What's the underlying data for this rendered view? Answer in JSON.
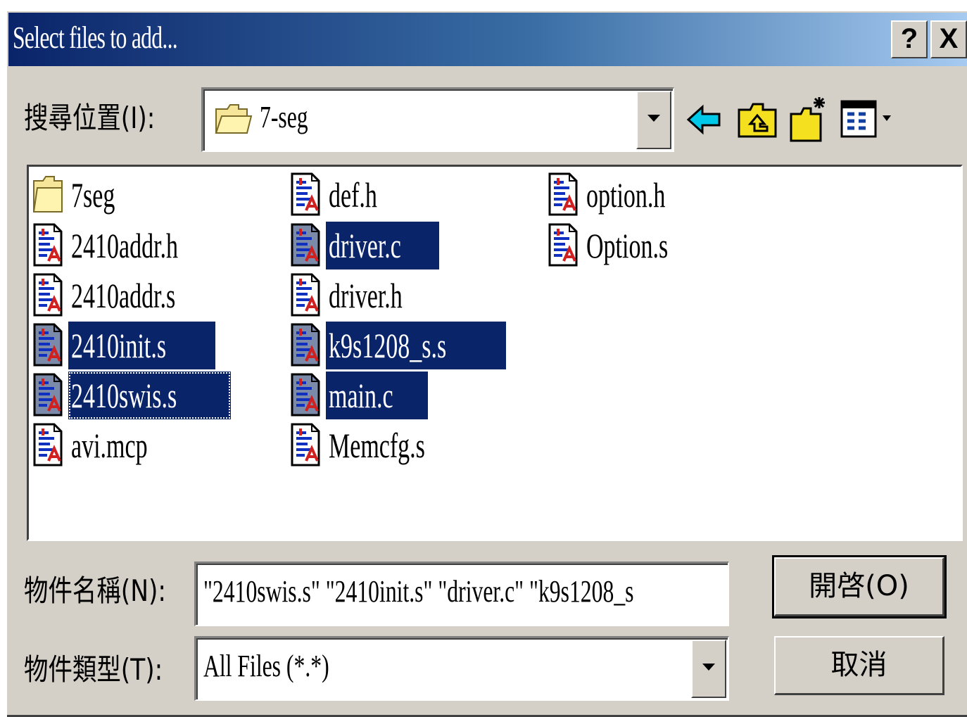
{
  "window": {
    "title": "Select files to add...",
    "help_label": "?",
    "close_label": "X"
  },
  "lookin": {
    "label": "搜尋位置(I):",
    "value": "7-seg",
    "folder_icon": "folder-icon"
  },
  "toolbar": {
    "back_icon": "back-arrow-icon",
    "up_icon": "up-folder-icon",
    "new_folder_icon": "new-folder-icon",
    "view_icon": "view-menu-icon"
  },
  "files": [
    {
      "name": "7seg",
      "type": "folder",
      "selected": false
    },
    {
      "name": "2410addr.h",
      "type": "doc",
      "selected": false
    },
    {
      "name": "2410addr.s",
      "type": "doc",
      "selected": false
    },
    {
      "name": "2410init.s",
      "type": "doc",
      "selected": true
    },
    {
      "name": "2410swis.s",
      "type": "doc",
      "selected": true,
      "focused": true
    },
    {
      "name": "avi.mcp",
      "type": "doc",
      "selected": false
    },
    {
      "name": "def.h",
      "type": "doc",
      "selected": false
    },
    {
      "name": "driver.c",
      "type": "doc",
      "selected": true
    },
    {
      "name": "driver.h",
      "type": "doc",
      "selected": false
    },
    {
      "name": "k9s1208_s.s",
      "type": "doc",
      "selected": true
    },
    {
      "name": "main.c",
      "type": "doc",
      "selected": true
    },
    {
      "name": "Memcfg.s",
      "type": "doc",
      "selected": false
    },
    {
      "name": "option.h",
      "type": "doc",
      "selected": false
    },
    {
      "name": "Option.s",
      "type": "doc",
      "selected": false
    }
  ],
  "filename": {
    "label": "物件名稱(N):",
    "value": "\"2410swis.s\" \"2410init.s\" \"driver.c\" \"k9s1208_s"
  },
  "filetype": {
    "label": "物件類型(T):",
    "value": "All Files (*.*)"
  },
  "buttons": {
    "open_label": "開啓(O)",
    "cancel_label": "取消"
  },
  "colors": {
    "title_start": "#0a246a",
    "title_end": "#a6caf0",
    "selection": "#0a246a",
    "dialog_bg": "#d4d0c8"
  }
}
